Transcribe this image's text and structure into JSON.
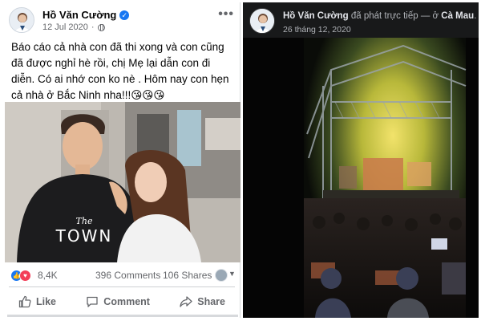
{
  "left_post": {
    "author": "Hồ Văn Cường",
    "date": "12 Jul 2020",
    "separator": "·",
    "more_label": "•••",
    "text": "Báo cáo cả nhà con đã thi xong và con cũng đã được nghỉ hè rồi, chị Mẹ lại dẫn con đi diễn. Có ai nhớ con ko nè . Hôm nay con hẹn cả nhà ở Bắc Ninh nha!!!😘😘😘",
    "photo_shirt_text_1": "The",
    "photo_shirt_text_2": "TOWN",
    "reactions_count": "8,4K",
    "comments_count": "396 Comments",
    "shares_count": "106 Shares",
    "actions": {
      "like": "Like",
      "comment": "Comment",
      "share": "Share"
    }
  },
  "right_post": {
    "author": "Hồ Văn Cường",
    "action_text": " đã phát trực tiếp — ở ",
    "location": "Cà Mau",
    "period": ".",
    "date": "26 tháng 12, 2020"
  },
  "icons": {
    "verified": "verified-badge-icon",
    "audience": "globe-icon",
    "more": "more-options-icon",
    "like_reaction": "like-reaction-icon",
    "love_reaction": "love-reaction-icon",
    "like_action": "thumbs-up-icon",
    "comment_action": "comment-bubble-icon",
    "share_action": "share-arrow-icon"
  },
  "colors": {
    "brand_blue": "#1877f2",
    "love_red": "#f33e58",
    "secondary_text": "#65676b",
    "dark_background": "#18191a"
  }
}
